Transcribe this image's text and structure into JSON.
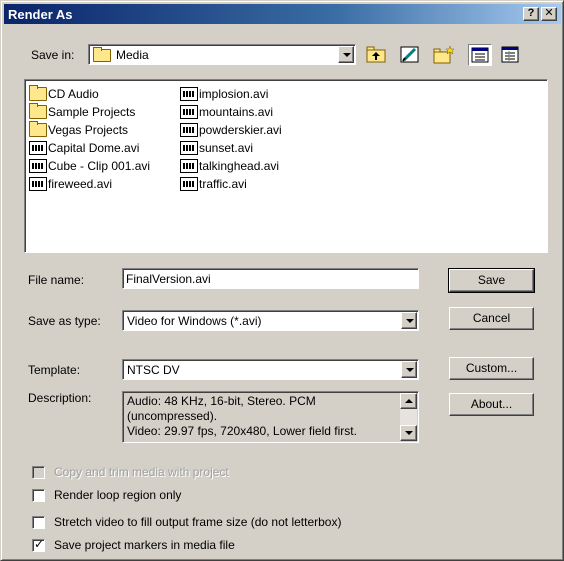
{
  "window": {
    "title": "Render As",
    "help_label": "?",
    "close_label": "✕"
  },
  "save_in": {
    "label": "Save in:",
    "value": "Media"
  },
  "toolbar": {
    "icons": [
      "up-one-level-icon",
      "desktop-icon",
      "new-folder-icon",
      "list-view-icon",
      "details-view-icon"
    ]
  },
  "files": {
    "col1": [
      {
        "name": "CD Audio",
        "type": "folder"
      },
      {
        "name": "Sample Projects",
        "type": "folder"
      },
      {
        "name": "Vegas Projects",
        "type": "folder"
      },
      {
        "name": "Capital Dome.avi",
        "type": "avi"
      },
      {
        "name": "Cube - Clip 001.avi",
        "type": "avi"
      },
      {
        "name": "fireweed.avi",
        "type": "avi"
      }
    ],
    "col2": [
      {
        "name": "implosion.avi",
        "type": "avi"
      },
      {
        "name": "mountains.avi",
        "type": "avi"
      },
      {
        "name": "powderskier.avi",
        "type": "avi"
      },
      {
        "name": "sunset.avi",
        "type": "avi"
      },
      {
        "name": "talkinghead.avi",
        "type": "avi"
      },
      {
        "name": "traffic.avi",
        "type": "avi"
      }
    ]
  },
  "form": {
    "file_name_label": "File name:",
    "file_name_value": "FinalVersion.avi",
    "save_type_label": "Save as type:",
    "save_type_value": "Video for Windows (*.avi)",
    "template_label": "Template:",
    "template_value": "NTSC DV",
    "description_label": "Description:",
    "description_lines": [
      "Audio: 48 KHz, 16-bit, Stereo. PCM",
      "(uncompressed).",
      "Video: 29.97 fps, 720x480, Lower field first."
    ]
  },
  "buttons": {
    "save": "Save",
    "cancel": "Cancel",
    "custom": "Custom...",
    "about": "About..."
  },
  "options": [
    {
      "label": "Copy and trim media with project",
      "checked": false,
      "disabled": true
    },
    {
      "label": "Render loop region only",
      "checked": false,
      "disabled": false
    },
    {
      "label": "Stretch video to fill output frame size (do not letterbox)",
      "checked": false,
      "disabled": false
    },
    {
      "label": "Save project markers in media file",
      "checked": true,
      "disabled": false
    }
  ]
}
